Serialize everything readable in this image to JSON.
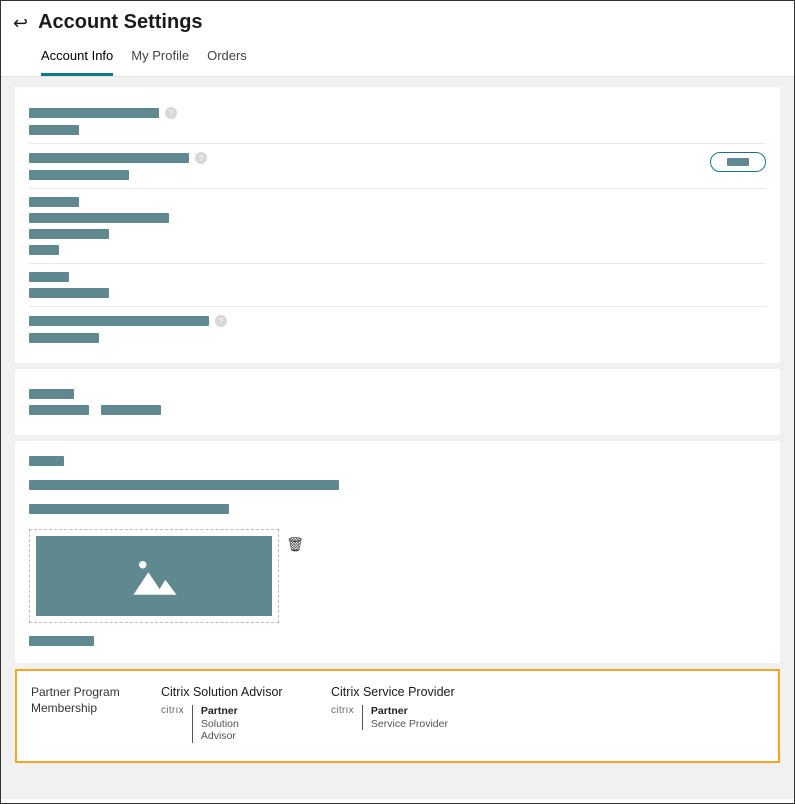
{
  "header": {
    "title": "Account Settings"
  },
  "tabs": [
    {
      "label": "Account Info",
      "active": true
    },
    {
      "label": "My Profile",
      "active": false
    },
    {
      "label": "Orders",
      "active": false
    }
  ],
  "partnerSection": {
    "heading": "Partner Program Membership",
    "columns": [
      {
        "title": "Citrix Solution Advisor",
        "brand": "citrıx",
        "line1": "Partner",
        "line2": "Solution",
        "line3": "Advisor"
      },
      {
        "title": "Citrix Service Provider",
        "brand": "citrıx",
        "line1": "Partner",
        "line2": "Service Provider",
        "line3": ""
      }
    ]
  },
  "helpIcon": "?"
}
